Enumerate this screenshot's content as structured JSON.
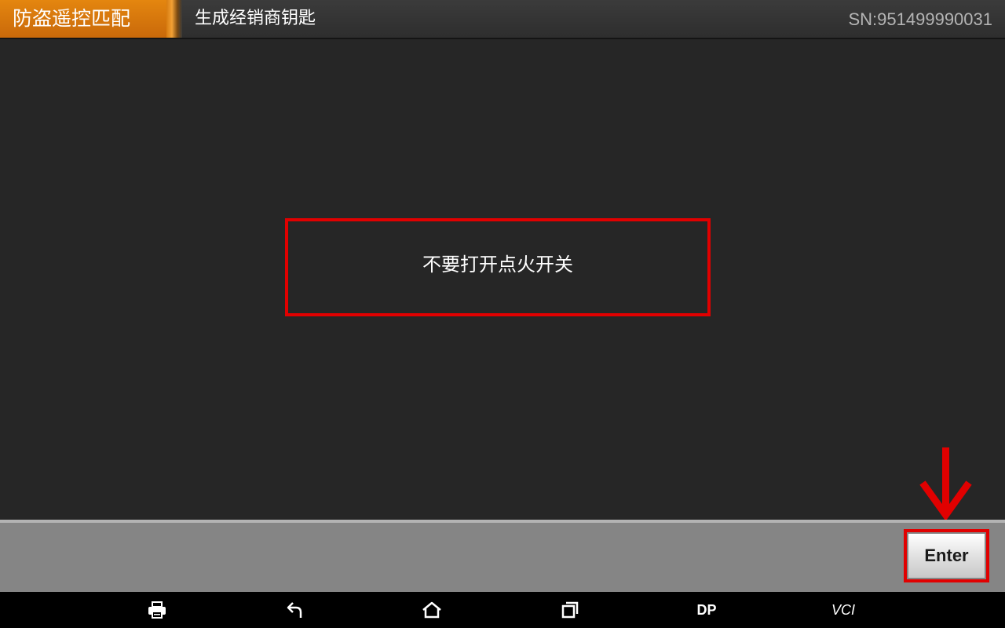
{
  "header": {
    "app_tab": "防盗遥控匹配",
    "page_title": "生成经销商钥匙",
    "serial": "SN:951499990031"
  },
  "message": {
    "text": "不要打开点火开关"
  },
  "actions": {
    "enter_label": "Enter"
  },
  "nav_bar": {
    "items": [
      {
        "icon": "print-icon"
      },
      {
        "icon": "back-icon"
      },
      {
        "icon": "home-icon"
      },
      {
        "icon": "recent-apps-icon"
      },
      {
        "label": "DP"
      },
      {
        "label": "VCI"
      }
    ]
  },
  "colors": {
    "app_tab": "#d97a0d",
    "highlight": "#e10000",
    "background": "#262626",
    "action_bar": "#858585"
  }
}
